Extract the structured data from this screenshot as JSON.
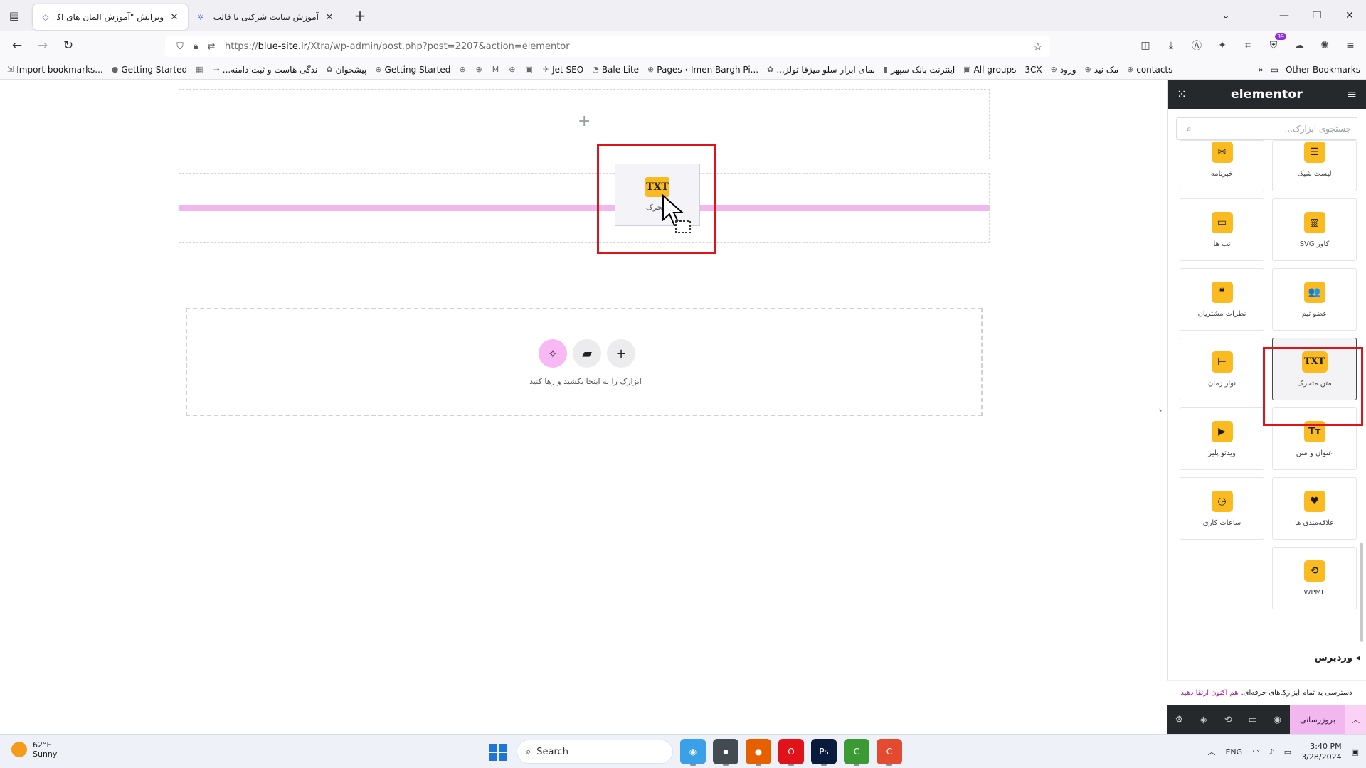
{
  "browser": {
    "tabs": [
      {
        "title": "ویرایش \"آموزش المان های اکسترا - ...",
        "active": true
      },
      {
        "title": "آموزش سایت شرکتی با قالب اکس...",
        "active": false
      }
    ],
    "url_prefix": "https://",
    "url_domain": "blue-site.ir",
    "url_path": "/Xtra/wp-admin/post.php?post=2207&action=elementor",
    "extension_badge": "39",
    "bookmarks": [
      {
        "label": "Import bookmarks...",
        "icon": "import-icon"
      },
      {
        "label": "Getting Started",
        "icon": "firefox-icon"
      },
      {
        "label": "",
        "icon": "calendar-icon"
      },
      {
        "label": "...ندگی هاست و ثبت دامنه",
        "icon": "arrow-icon"
      },
      {
        "label": "پیشخوان",
        "icon": "gear-icon"
      },
      {
        "label": "Getting Started",
        "icon": "globe-icon"
      },
      {
        "label": "",
        "icon": "globe-icon"
      },
      {
        "label": "",
        "icon": "globe-icon"
      },
      {
        "label": "",
        "icon": "gmail-icon"
      },
      {
        "label": "",
        "icon": "globe-icon"
      },
      {
        "label": "",
        "icon": "square-icon"
      },
      {
        "label": "Jet SEO",
        "icon": "rocket-icon"
      },
      {
        "label": "Bale Lite",
        "icon": "bale-icon"
      },
      {
        "label": "Pages ‹ Imen Bargh Pi...",
        "icon": "globe-icon"
      },
      {
        "label": "...نمای ابزار سلو میزفا تولز",
        "icon": "gear-icon"
      },
      {
        "label": "اینترنت بانک سپهر",
        "icon": "bank-icon"
      },
      {
        "label": "All groups - 3CX",
        "icon": "square-icon"
      },
      {
        "label": "ورود",
        "icon": "globe-icon"
      },
      {
        "label": "مک نید",
        "icon": "globe-icon"
      },
      {
        "label": "contacts",
        "icon": "globe-icon"
      }
    ],
    "other_bookmarks": "Other Bookmarks"
  },
  "canvas": {
    "drag_label": "متحرک",
    "drag_icon_text": "TXT",
    "empty_hint": "ابزارک را به اینجا بکشید و رها کنید"
  },
  "panel": {
    "logo": "elementor",
    "search_placeholder": "جستجوی ابزارک...",
    "widgets": [
      {
        "label": "لیست شیک",
        "icon": "list-icon",
        "glyph": "☰",
        "selected": false
      },
      {
        "label": "خبرنامه",
        "icon": "envelope-icon",
        "glyph": "✉",
        "selected": false
      },
      {
        "label": "کاور SVG",
        "icon": "svg-cover-icon",
        "glyph": "▨",
        "selected": false
      },
      {
        "label": "تب ها",
        "icon": "folder-icon",
        "glyph": "▭",
        "selected": false
      },
      {
        "label": "عضو تیم",
        "icon": "team-icon",
        "glyph": "👥",
        "selected": false
      },
      {
        "label": "نظرات مشتریان",
        "icon": "quote-icon",
        "glyph": "❝",
        "selected": false
      },
      {
        "label": "متن متحرک",
        "icon": "txt-icon",
        "glyph": "TXT",
        "selected": true
      },
      {
        "label": "نوار زمان",
        "icon": "timeline-icon",
        "glyph": "⊣",
        "selected": false
      },
      {
        "label": "عنوان و متن",
        "icon": "heading-text-icon",
        "glyph": "Tт",
        "selected": false
      },
      {
        "label": "ویدئو پلیر",
        "icon": "video-icon",
        "glyph": "▶",
        "selected": false
      },
      {
        "label": "علاقه‌مندی ها",
        "icon": "heart-icon",
        "glyph": "♥",
        "selected": false
      },
      {
        "label": "ساعات کاری",
        "icon": "clock-icon",
        "glyph": "◷",
        "selected": false
      },
      {
        "label": "WPML",
        "icon": "wpml-icon",
        "glyph": "⟲",
        "selected": false
      }
    ],
    "wordpress_heading": "وردپرس",
    "promo_text": "دسترسی به تمام ابزارک‌های حرفه‌ای.",
    "promo_link": "هم اکنون ارتقا دهید",
    "publish_label": "بروزرسانی"
  },
  "taskbar": {
    "temp": "62°F",
    "condition": "Sunny",
    "search": "Search",
    "lang": "ENG",
    "time": "3:40 PM",
    "date": "3/28/2024",
    "apps": [
      {
        "name": "copilot-app",
        "color": "#3aa0e8",
        "glyph": "◉"
      },
      {
        "name": "files-app",
        "color": "#444a52",
        "glyph": "▪"
      },
      {
        "name": "firefox-app",
        "color": "#e66000",
        "glyph": "●"
      },
      {
        "name": "opera-app",
        "color": "#e0121a",
        "glyph": "O"
      },
      {
        "name": "photoshop-app",
        "color": "#0a1a3c",
        "glyph": "Ps"
      },
      {
        "name": "camtasia-green-app",
        "color": "#3c9a34",
        "glyph": "C"
      },
      {
        "name": "camtasia-red-app",
        "color": "#e34a2f",
        "glyph": "C"
      }
    ]
  }
}
